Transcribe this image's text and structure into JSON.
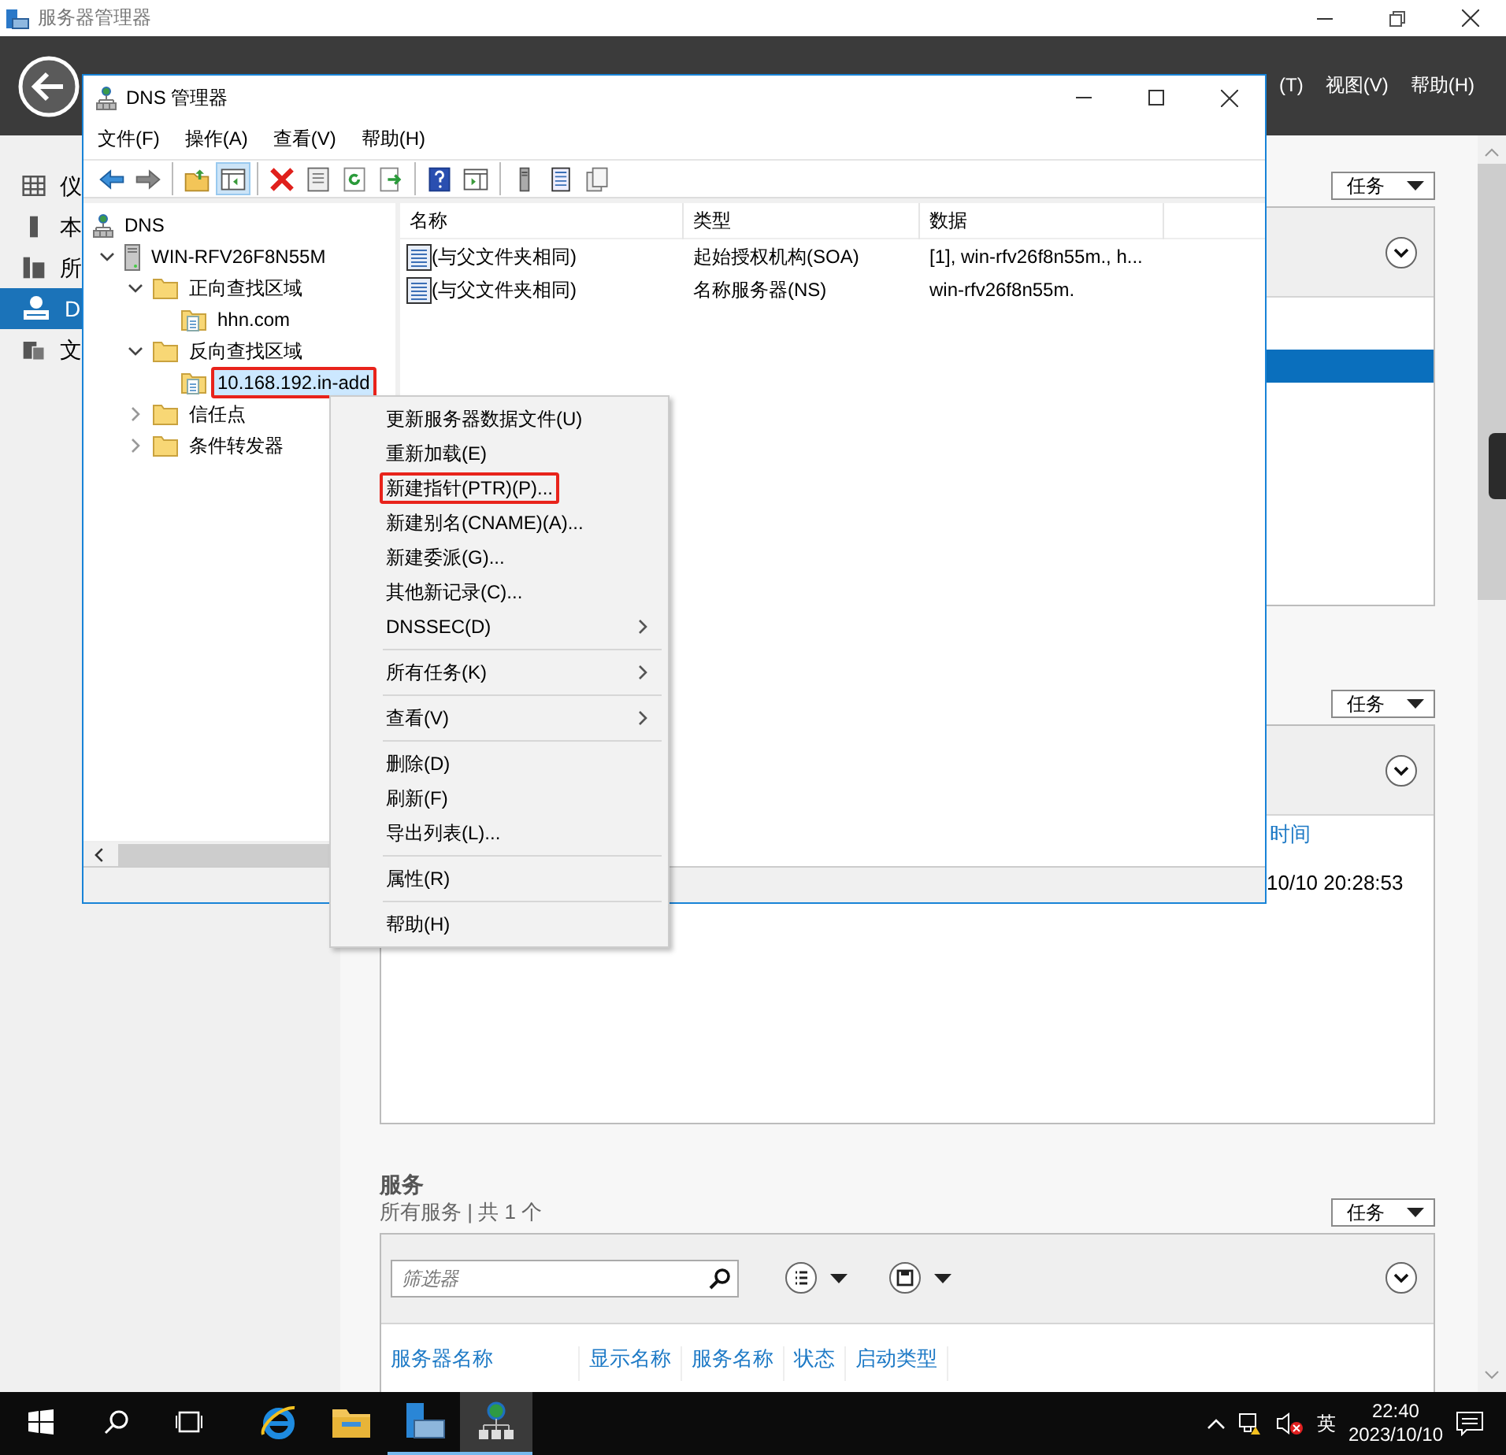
{
  "app_window": {
    "title": "服务器管理器",
    "menu": [
      "(T)",
      "视图(V)",
      "帮助(H)"
    ]
  },
  "nav": [
    {
      "label": "仪",
      "selected": false
    },
    {
      "label": "本",
      "selected": false
    },
    {
      "label": "所",
      "selected": false
    },
    {
      "label": "D",
      "selected": true
    },
    {
      "label": "文",
      "selected": false
    }
  ],
  "panels": [
    {
      "tasks": "任务",
      "highlighted_row": true
    },
    {
      "tasks": "任务",
      "column": "时间",
      "cell": "10/10 20:28:53"
    }
  ],
  "services": {
    "title": "服务",
    "subtitle": "所有服务 | 共 1 个",
    "tasks": "任务",
    "filter": {
      "placeholder": "筛选器"
    },
    "columns": [
      "服务器名称",
      "显示名称",
      "服务名称",
      "状态",
      "启动类型"
    ]
  },
  "dns_window": {
    "title": "DNS 管理器",
    "menu": [
      "文件(F)",
      "操作(A)",
      "查看(V)",
      "帮助(H)"
    ],
    "toolbar": [
      [
        {
          "kind": "back",
          "pressed": false
        },
        {
          "kind": "forward",
          "pressed": false
        }
      ],
      [
        {
          "kind": "up",
          "pressed": false
        },
        {
          "kind": "tree",
          "pressed": true
        }
      ],
      [
        {
          "kind": "delete",
          "pressed": false
        },
        {
          "kind": "properties",
          "pressed": false
        },
        {
          "kind": "refresh",
          "pressed": false
        },
        {
          "kind": "export",
          "pressed": false
        }
      ],
      [
        {
          "kind": "help",
          "pressed": false
        },
        {
          "kind": "pane",
          "pressed": false
        }
      ],
      [
        {
          "kind": "server",
          "pressed": false
        },
        {
          "kind": "list",
          "pressed": false
        },
        {
          "kind": "copy",
          "pressed": false
        }
      ]
    ],
    "tree": [
      {
        "kind": "dns",
        "label": "DNS",
        "children": [
          {
            "kind": "server",
            "label": "WIN-RFV26F8N55M",
            "expanded": true,
            "children": [
              {
                "kind": "folder",
                "label": "正向查找区域",
                "expanded": true,
                "children": [
                  {
                    "kind": "zone",
                    "label": "hhn.com",
                    "selected": false,
                    "annotated": false
                  }
                ]
              },
              {
                "kind": "folder",
                "label": "反向查找区域",
                "expanded": true,
                "children": [
                  {
                    "kind": "zone",
                    "label": "10.168.192.in-add",
                    "selected": true,
                    "annotated": true
                  }
                ]
              },
              {
                "kind": "folder",
                "label": "信任点",
                "expanded": false
              },
              {
                "kind": "folder",
                "label": "条件转发器",
                "expanded": false
              }
            ]
          }
        ]
      }
    ],
    "columns": [
      "名称",
      "类型",
      "数据"
    ],
    "rows": [
      [
        "(与父文件夹相同)",
        "起始授权机构(SOA)",
        "[1], win-rfv26f8n55m., h..."
      ],
      [
        "(与父文件夹相同)",
        "名称服务器(NS)",
        "win-rfv26f8n55m."
      ]
    ]
  },
  "context_menu": [
    {
      "kind": "item",
      "label": "更新服务器数据文件(U)",
      "submenu": false,
      "annotated": false
    },
    {
      "kind": "item",
      "label": "重新加载(E)",
      "submenu": false,
      "annotated": false
    },
    {
      "kind": "item",
      "label": "新建指针(PTR)(P)...",
      "submenu": false,
      "annotated": true
    },
    {
      "kind": "item",
      "label": "新建别名(CNAME)(A)...",
      "submenu": false,
      "annotated": false
    },
    {
      "kind": "item",
      "label": "新建委派(G)...",
      "submenu": false,
      "annotated": false
    },
    {
      "kind": "item",
      "label": "其他新记录(C)...",
      "submenu": false,
      "annotated": false
    },
    {
      "kind": "item",
      "label": "DNSSEC(D)",
      "submenu": true,
      "annotated": false
    },
    {
      "kind": "separator"
    },
    {
      "kind": "item",
      "label": "所有任务(K)",
      "submenu": true,
      "annotated": false
    },
    {
      "kind": "separator"
    },
    {
      "kind": "item",
      "label": "查看(V)",
      "submenu": true,
      "annotated": false
    },
    {
      "kind": "separator"
    },
    {
      "kind": "item",
      "label": "删除(D)",
      "submenu": false,
      "annotated": false
    },
    {
      "kind": "item",
      "label": "刷新(F)",
      "submenu": false,
      "annotated": false
    },
    {
      "kind": "item",
      "label": "导出列表(L)...",
      "submenu": false,
      "annotated": false
    },
    {
      "kind": "separator"
    },
    {
      "kind": "item",
      "label": "属性(R)",
      "submenu": false,
      "annotated": false
    },
    {
      "kind": "separator"
    },
    {
      "kind": "item",
      "label": "帮助(H)",
      "submenu": false,
      "annotated": false
    }
  ],
  "taskbar": {
    "buttons": [
      {
        "kind": "start",
        "running": false,
        "active": false
      },
      {
        "kind": "search",
        "running": false,
        "active": false
      },
      {
        "kind": "taskview",
        "running": false,
        "active": false
      },
      {
        "kind": "ie",
        "running": false,
        "active": false
      },
      {
        "kind": "explorer",
        "running": false,
        "active": false
      },
      {
        "kind": "servermanager",
        "running": true,
        "active": false
      },
      {
        "kind": "dns",
        "running": true,
        "active": true
      }
    ],
    "input": "英",
    "time": "22:40",
    "date": "2023/10/10"
  }
}
